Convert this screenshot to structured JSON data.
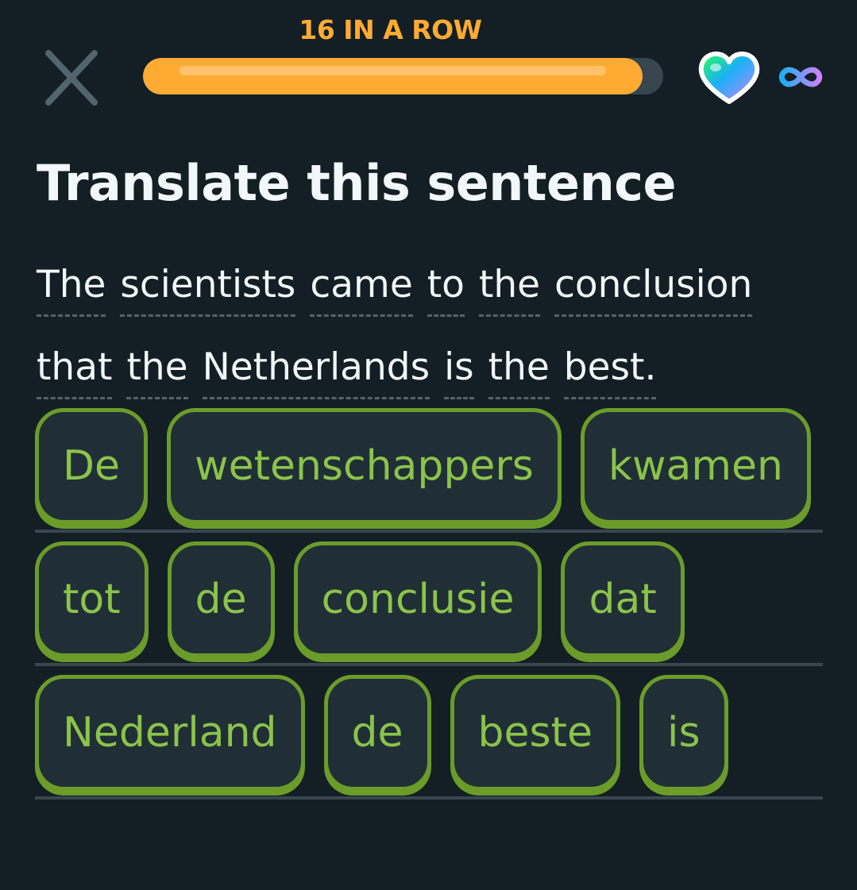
{
  "header": {
    "streak_label": "16 IN A ROW",
    "progress_fraction": 0.96,
    "close_icon": "close-icon",
    "heart_icon": "super-heart-icon",
    "infinity_icon": "infinity-icon"
  },
  "challenge": {
    "title": "Translate this sentence",
    "prompt_lines": [
      [
        "The",
        "scientists",
        "came",
        "to",
        "the",
        "conclusion"
      ],
      [
        "that",
        "the",
        "Netherlands",
        "is",
        "the",
        "best."
      ]
    ]
  },
  "word_bank": {
    "rows": [
      [
        "De",
        "wetenschappers",
        "kwamen"
      ],
      [
        "tot",
        "de",
        "conclusie",
        "dat"
      ],
      [
        "Nederland",
        "de",
        "beste",
        "is"
      ]
    ]
  },
  "colors": {
    "background": "#131f24",
    "streak_orange": "#ffab33",
    "tile_green": "#8bc34a",
    "tile_border": "#6b9c2a"
  }
}
